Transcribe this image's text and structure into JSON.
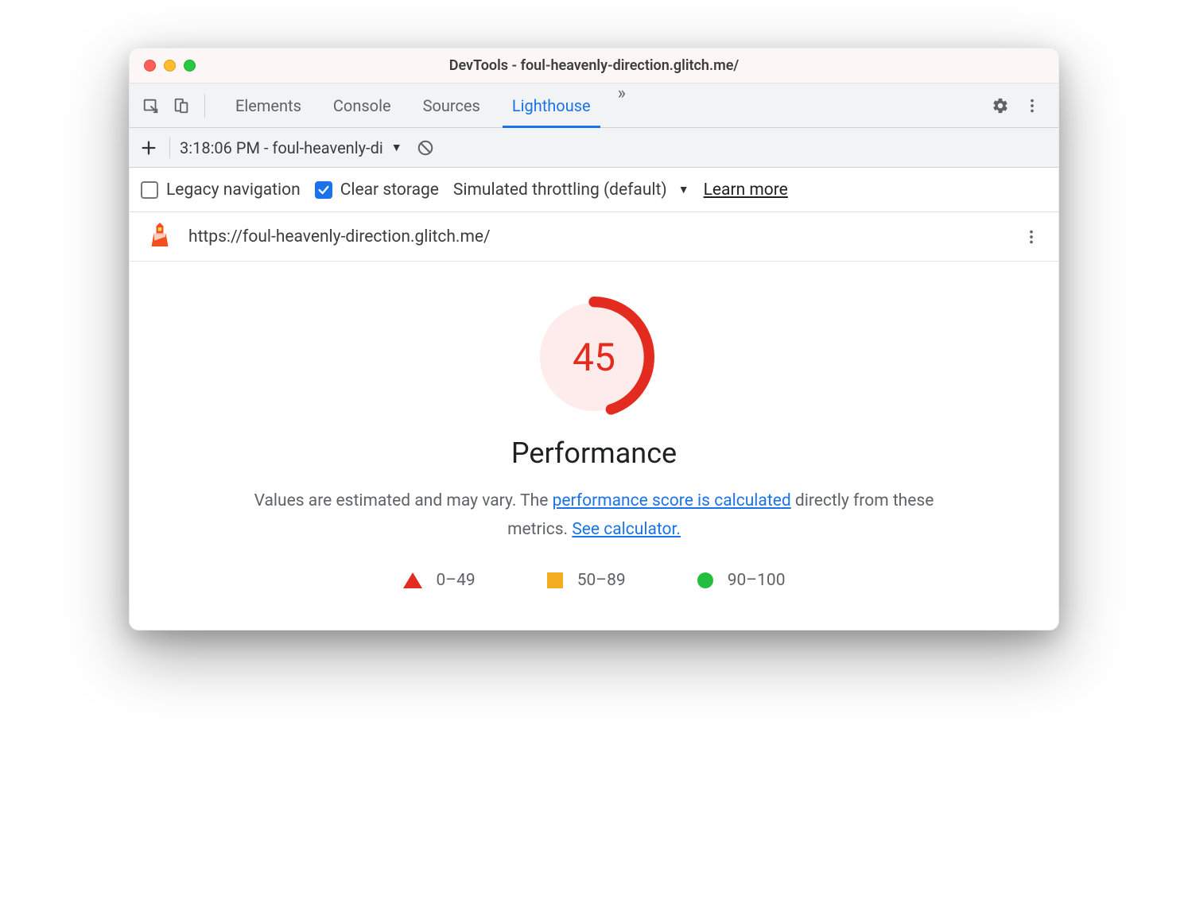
{
  "window": {
    "title": "DevTools - foul-heavenly-direction.glitch.me/"
  },
  "tabs": {
    "elements": "Elements",
    "console": "Console",
    "sources": "Sources",
    "lighthouse": "Lighthouse"
  },
  "report_row": {
    "select_text": "3:18:06 PM - foul-heavenly-di"
  },
  "options": {
    "legacy_nav": "Legacy navigation",
    "clear_storage": "Clear storage",
    "throttling": "Simulated throttling (default)",
    "learn_more": "Learn more"
  },
  "url_row": {
    "url": "https://foul-heavenly-direction.glitch.me/"
  },
  "report": {
    "score": "45",
    "score_numeric": 45,
    "title": "Performance",
    "desc_prefix": "Values are estimated and may vary. The ",
    "desc_link1": "performance score is calculated",
    "desc_middle": " directly from these metrics. ",
    "desc_link2": "See calculator."
  },
  "legend": {
    "fail": "0–49",
    "average": "50–89",
    "pass": "90–100"
  },
  "colors": {
    "fail": "#e42b1f",
    "average": "#f4ad1f",
    "pass": "#24be3f",
    "link": "#1a73e8"
  }
}
